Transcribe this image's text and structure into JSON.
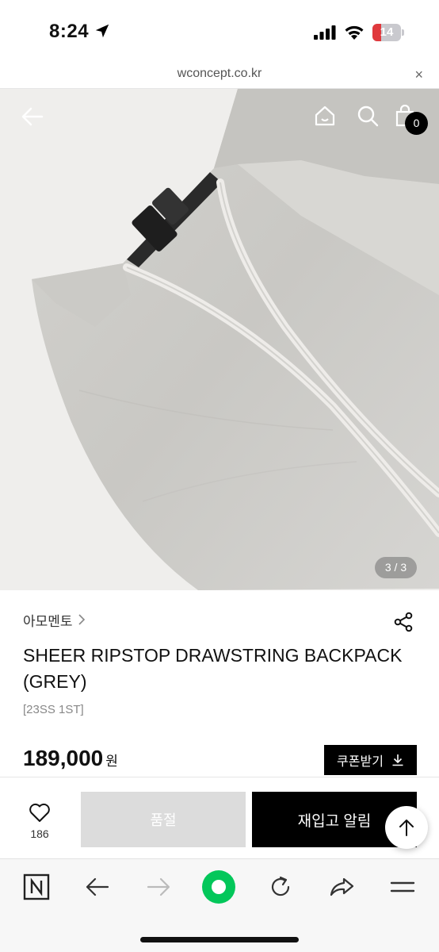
{
  "status_bar": {
    "time": "8:24",
    "battery_level": "14",
    "battery_fraction": 0.14
  },
  "browser": {
    "url": "wconcept.co.kr",
    "close_glyph": "×"
  },
  "product_image": {
    "page_indicator": "3 / 3",
    "cart_count": "0"
  },
  "product": {
    "brand": "아모멘토",
    "title": "SHEER RIPSTOP DRAWSTRING BACKPACK (GREY)",
    "tag": "[23SS 1ST]",
    "price": "189,000",
    "price_unit": "원",
    "coupon_label": "쿠폰받기"
  },
  "action_bar": {
    "like_count": "186",
    "soldout_label": "품절",
    "restock_label": "재입고 알림"
  },
  "icons": {
    "status": [
      "location-icon",
      "signal-icon",
      "wifi-icon",
      "battery-icon"
    ],
    "image_nav": [
      "back-icon",
      "home-icon",
      "search-icon",
      "bag-icon"
    ],
    "toolbar": [
      "naver-n-icon",
      "back-arrow-icon",
      "forward-arrow-icon",
      "green-dot-icon",
      "reload-icon",
      "share-icon",
      "menu-icon"
    ]
  },
  "colors": {
    "accent": "#000000",
    "soldout_bg": "#dcdcdc",
    "battery_low": "#e0393d",
    "green_button": "#03c75a"
  }
}
